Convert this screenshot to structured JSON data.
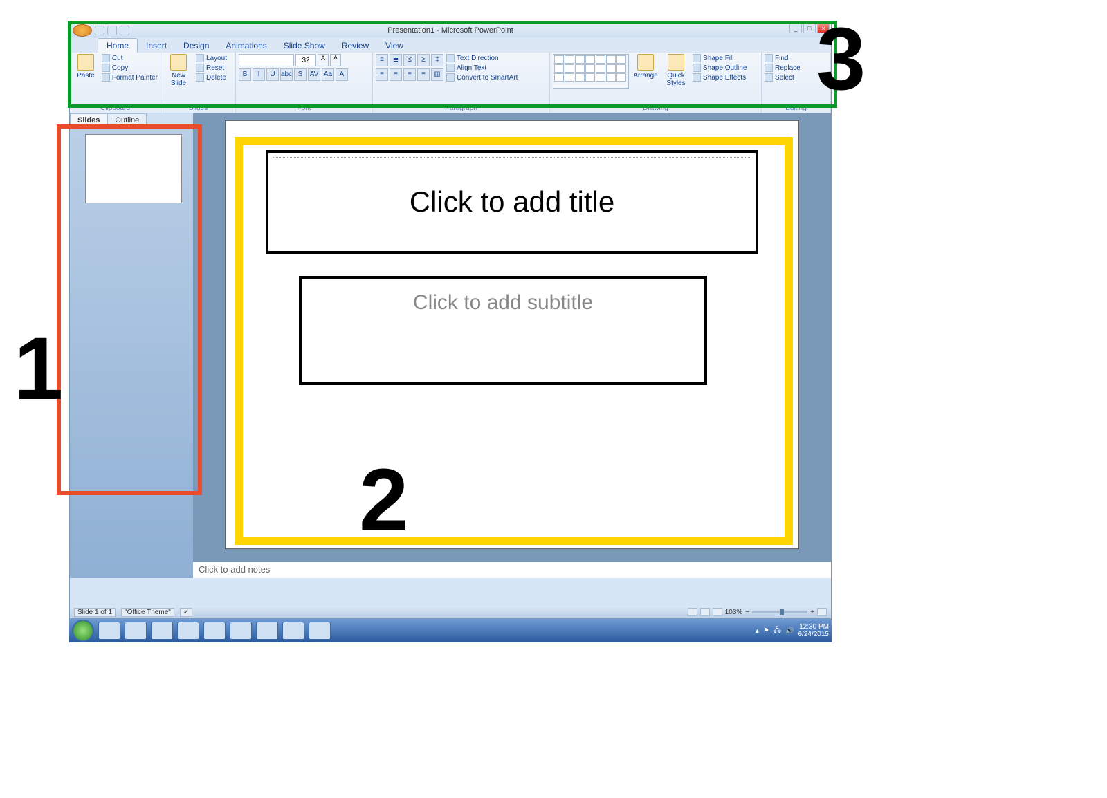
{
  "window": {
    "title": "Presentation1 - Microsoft PowerPoint"
  },
  "ribbon": {
    "tabs": [
      "Home",
      "Insert",
      "Design",
      "Animations",
      "Slide Show",
      "Review",
      "View"
    ],
    "active_tab": "Home",
    "groups": {
      "clipboard": {
        "label": "Clipboard",
        "paste": "Paste",
        "cut": "Cut",
        "copy": "Copy",
        "format_painter": "Format Painter"
      },
      "slides": {
        "label": "Slides",
        "new_slide": "New Slide",
        "layout": "Layout",
        "reset": "Reset",
        "delete": "Delete"
      },
      "font": {
        "label": "Font",
        "size": "32",
        "bold": "B",
        "italic": "I",
        "underline": "U",
        "strike": "abc",
        "shadow": "S",
        "spacing": "AV",
        "case": "Aa",
        "color": "A"
      },
      "paragraph": {
        "label": "Paragraph",
        "text_direction": "Text Direction",
        "align_text": "Align Text",
        "convert_smartart": "Convert to SmartArt"
      },
      "drawing": {
        "label": "Drawing",
        "arrange": "Arrange",
        "quick_styles": "Quick Styles",
        "shape_fill": "Shape Fill",
        "shape_outline": "Shape Outline",
        "shape_effects": "Shape Effects"
      },
      "editing": {
        "label": "Editing",
        "find": "Find",
        "replace": "Replace",
        "select": "Select"
      }
    }
  },
  "side_tabs": {
    "slides": "Slides",
    "outline": "Outline"
  },
  "slide": {
    "title_placeholder": "Click to add title",
    "subtitle_placeholder": "Click to add subtitle"
  },
  "notes": {
    "placeholder": "Click to add notes"
  },
  "status": {
    "slide_info": "Slide 1 of 1",
    "theme": "\"Office Theme\"",
    "zoom": "103%"
  },
  "taskbar": {
    "time": "12:30 PM",
    "date": "6/24/2015"
  },
  "annotations": {
    "n1": "1",
    "n2": "2",
    "n3": "3"
  }
}
